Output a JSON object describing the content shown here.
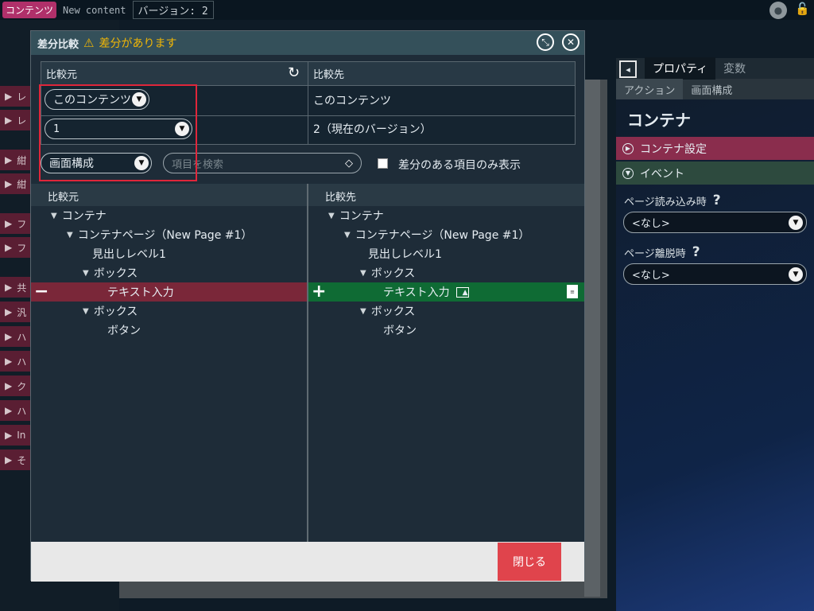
{
  "topbar": {
    "tag": "コンテンツ",
    "new_content": "New content",
    "version": "バージョン: 2"
  },
  "background_left": {
    "items": [
      "レ",
      "レ",
      "紺",
      "紺",
      "フ",
      "フ",
      "共",
      "汎",
      "ハ",
      "ハ",
      "ク",
      "ハ",
      "In",
      "そ"
    ]
  },
  "dialog": {
    "title": "差分比較",
    "warning": "差分があります",
    "compare": {
      "source_header": "比較元",
      "target_header": "比較先",
      "source_content_select": "このコンテンツ",
      "target_content": "このコンテンツ",
      "source_version_select": "1",
      "target_version": "2（現在のバージョン）"
    },
    "filter": {
      "view_select": "画面構成",
      "search_placeholder": "項目を検索",
      "diff_only_label": "差分のある項目のみ表示",
      "diff_only_checked": false
    },
    "tree": {
      "source_header": "比較元",
      "target_header": "比較先",
      "source_nodes": [
        {
          "label": "コンテナ",
          "caret": true
        },
        {
          "label": "コンテナページ（New Page #1）",
          "caret": true
        },
        {
          "label": "見出しレベル1",
          "caret": false
        },
        {
          "label": "ボックス",
          "caret": true
        },
        {
          "label": "テキスト入力",
          "caret": false,
          "status": "removed",
          "marker": "−"
        },
        {
          "label": "ボックス",
          "caret": true
        },
        {
          "label": "ボタン",
          "caret": false
        }
      ],
      "target_nodes": [
        {
          "label": "コンテナ",
          "caret": true
        },
        {
          "label": "コンテナページ（New Page #1）",
          "caret": true
        },
        {
          "label": "見出しレベル1",
          "caret": false
        },
        {
          "label": "ボックス",
          "caret": true
        },
        {
          "label": "テキスト入力",
          "caret": false,
          "status": "added",
          "marker": "+"
        },
        {
          "label": "ボックス",
          "caret": true
        },
        {
          "label": "ボタン",
          "caret": false
        }
      ]
    },
    "close_label": "閉じる"
  },
  "right_panel": {
    "tabs": [
      "プロパティ",
      "変数"
    ],
    "sub_tabs": [
      "アクション",
      "画面構成"
    ],
    "title": "コンテナ",
    "sections": [
      "コンテナ設定",
      "イベント"
    ],
    "events": [
      {
        "label": "ページ読み込み時",
        "value": "<なし>"
      },
      {
        "label": "ページ離脱時",
        "value": "<なし>"
      }
    ]
  },
  "colors": {
    "removed": "#7a2739",
    "added": "#0f6b34",
    "highlight_box": "#e0263a",
    "close_button": "#e0444c",
    "warning": "#f2b705"
  },
  "icons": [
    "warning-icon",
    "refresh-icon",
    "chevron-down-icon",
    "eraser-icon",
    "image-icon",
    "document-icon",
    "collapse-icon",
    "close-icon",
    "user-icon",
    "lock-icon",
    "panel-toggle-icon",
    "help-icon"
  ]
}
